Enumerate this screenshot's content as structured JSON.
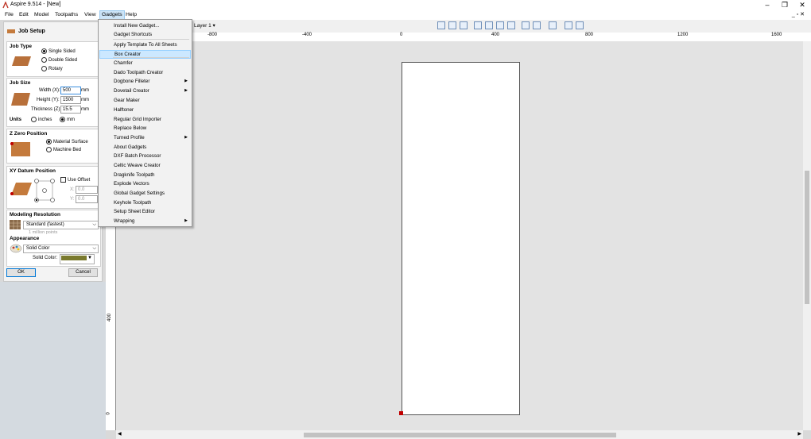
{
  "window": {
    "title": "Aspire 9.514 - [New]",
    "buttons": [
      "–",
      "❐",
      "✕"
    ],
    "mdi_buttons": "_ ▫ ✕"
  },
  "menubar": {
    "items": [
      "File",
      "Edit",
      "Model",
      "Toolpaths",
      "View",
      "Gadgets",
      "Help"
    ]
  },
  "gadgets_menu": {
    "items": [
      {
        "label": "Install New Gadget...",
        "sub": false
      },
      {
        "label": "Gadget Shortcuts",
        "sub": false
      },
      {
        "label": "Apply Template To All Sheets",
        "sub": false
      },
      {
        "label": "Box Creator",
        "sub": false,
        "highlighted": true
      },
      {
        "label": "Chamfer",
        "sub": false
      },
      {
        "label": "Dado Toolpath Creator",
        "sub": false
      },
      {
        "label": "Dogbone Filleter",
        "sub": true
      },
      {
        "label": "Dovetail Creator",
        "sub": true
      },
      {
        "label": "Gear Maker",
        "sub": false
      },
      {
        "label": "Halftoner",
        "sub": false
      },
      {
        "label": "Regular Grid Importer",
        "sub": false
      },
      {
        "label": "Replace Below",
        "sub": false
      },
      {
        "label": "Turned Profile",
        "sub": true
      },
      {
        "label": "About Gadgets",
        "sub": false
      },
      {
        "label": "DXF Batch Processor",
        "sub": false
      },
      {
        "label": "Celtic Weave Creator",
        "sub": false
      },
      {
        "label": "Dragknife Toolpath",
        "sub": false
      },
      {
        "label": "Explode Vectors",
        "sub": false
      },
      {
        "label": "Global Gadget Settings",
        "sub": false
      },
      {
        "label": "Keyhole Toolpath",
        "sub": false
      },
      {
        "label": "Setup Sheet Editor",
        "sub": false
      },
      {
        "label": "Wrapping",
        "sub": true
      }
    ],
    "submenu_arrow": "▶"
  },
  "job_setup": {
    "title": "Job Setup",
    "job_type": {
      "title": "Job Type",
      "options": [
        "Single Sided",
        "Double Sided",
        "Rotary"
      ],
      "selected": "Single Sided"
    },
    "job_size": {
      "title": "Job Size",
      "width_label": "Width (X):",
      "width": "500",
      "height_label": "Height (Y):",
      "height": "1500",
      "thickness_label": "Thickness (Z):",
      "thickness": "15.5",
      "unit": "mm",
      "units_label": "Units",
      "unit_options": [
        "inches",
        "mm"
      ],
      "unit_selected": "mm"
    },
    "z_zero": {
      "title": "Z Zero Position",
      "options": [
        "Material Surface",
        "Machine Bed"
      ],
      "selected": "Material Surface"
    },
    "xy_datum": {
      "title": "XY Datum Position",
      "use_offset": "Use Offset",
      "x_label": "X:",
      "x_value": "0.0",
      "y_label": "Y:",
      "y_value": "0.0"
    },
    "modeling": {
      "title": "Modeling Resolution",
      "value": "Standard (fastest)",
      "note": "1 million points"
    },
    "appearance": {
      "title": "Appearance",
      "value": "Solid Color",
      "solid_color_label": "Solid Color:",
      "solid_color": "#7a7a2e"
    },
    "ok": "OK",
    "cancel": "Cancel"
  },
  "toolbar": {
    "layer": "Layer 1 ▾"
  },
  "rulers": {
    "horizontal": [
      "-800",
      "-400",
      "0",
      "400",
      "800",
      "1200",
      "1600"
    ],
    "vertical": [
      "400",
      "0"
    ]
  },
  "colors": {
    "accent": "#0078d7",
    "highlight": "#cce8ff",
    "origin_marker": "#c00000"
  }
}
